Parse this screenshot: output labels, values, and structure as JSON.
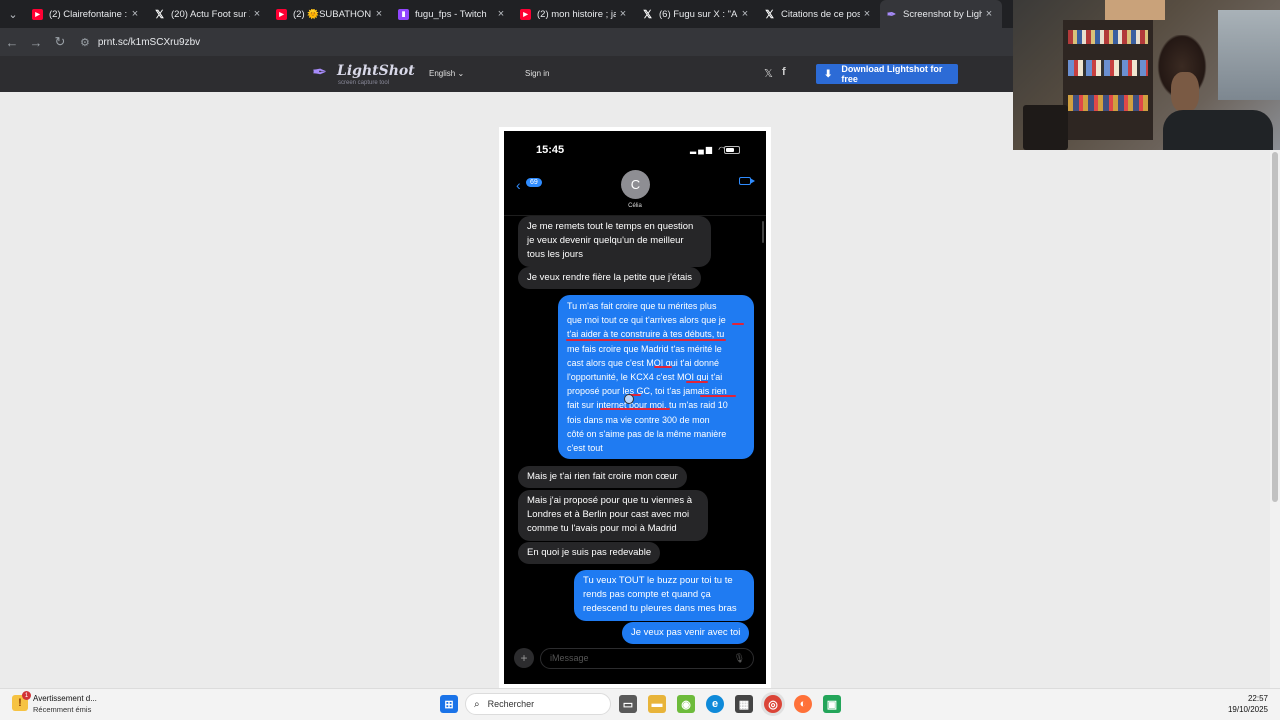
{
  "browser": {
    "tabs": [
      {
        "icon": "youtube-icon",
        "title": "(2) Clairefontaine : l'e",
        "active": false
      },
      {
        "icon": "x-icon",
        "title": "(20) Actu Foot sur X :",
        "active": false
      },
      {
        "icon": "youtube-icon",
        "title": "(2) 🌞SUBATHON V3",
        "active": false
      },
      {
        "icon": "twitch-icon",
        "title": "fugu_fps - Twitch",
        "active": false
      },
      {
        "icon": "youtube-icon",
        "title": "(2) mon histoire ; jalo",
        "active": false
      },
      {
        "icon": "x-icon",
        "title": "(6) Fugu sur X : \"Aujo",
        "active": false
      },
      {
        "icon": "x-icon",
        "title": "Citations de ce post",
        "active": false
      },
      {
        "icon": "lightshot-icon",
        "title": "Screenshot by Lights",
        "active": true
      }
    ],
    "close_glyph": "×",
    "url": "prnt.sc/k1mSCXru9zbv"
  },
  "lightshot": {
    "logo_name": "LightShot",
    "logo_tagline": "screen capture tool",
    "language": "English",
    "signin": "Sign in",
    "twitter": "𝕏",
    "facebook": "f",
    "download_label": "Download Lightshot for free"
  },
  "phone": {
    "time": "15:45",
    "back_count": "69",
    "avatar_letter": "C",
    "contact_name": "Célia",
    "compose_placeholder": "iMessage",
    "messages": [
      {
        "dir": "recv",
        "lines": [
          "Je me remets tout le temps en question",
          "je veux devenir quelqu'un de meilleur",
          "tous les jours"
        ]
      },
      {
        "dir": "recv",
        "lines": [
          "Je veux rendre fière la petite que j'étais"
        ]
      },
      {
        "dir": "sent",
        "lines": [
          "Tu m'as fait croire que tu mérites plus",
          "que moi tout ce qui t'arrives alors que je",
          "t'ai aider à te construire à tes débuts, tu",
          "me fais croire que Madrid t'as mérité le",
          "cast alors que c'est MOI qui t'ai donné",
          "l'opportunité, le KCX4 c'est MOI qui t'ai",
          "proposé pour les GC, toi t'as jamais rien",
          "fait sur internet pour moi, tu m'as raid 10",
          "fois dans ma vie contre 300 de mon",
          "côté on s'aime pas de la même manière",
          "c'est tout"
        ]
      },
      {
        "dir": "recv",
        "lines": [
          "Mais je t'ai rien fait croire mon cœur"
        ]
      },
      {
        "dir": "recv",
        "lines": [
          "Mais j'ai proposé pour que tu viennes à",
          "Londres et à Berlin pour cast avec moi",
          "comme tu l'avais pour moi à Madrid"
        ]
      },
      {
        "dir": "recv",
        "lines": [
          "En quoi je suis pas redevable"
        ]
      },
      {
        "dir": "sent",
        "lines": [
          "Tu veux TOUT le buzz pour toi tu te",
          "rends pas compte et quand ça",
          "redescend tu pleures dans mes bras"
        ]
      },
      {
        "dir": "sent",
        "lines": [
          "Je veux pas venir avec toi"
        ]
      }
    ]
  },
  "taskbar": {
    "notif_title": "Avertissement d...",
    "notif_sub": "Récemment émis",
    "notif_badge": "1",
    "search_placeholder": "Rechercher",
    "time": "22:57",
    "date": "19/10/2025"
  },
  "colors": {
    "sent_bubble": "#1f7bf2",
    "recv_bubble": "#262628",
    "underline": "#e0243a",
    "download_button": "#2c6bd6"
  }
}
